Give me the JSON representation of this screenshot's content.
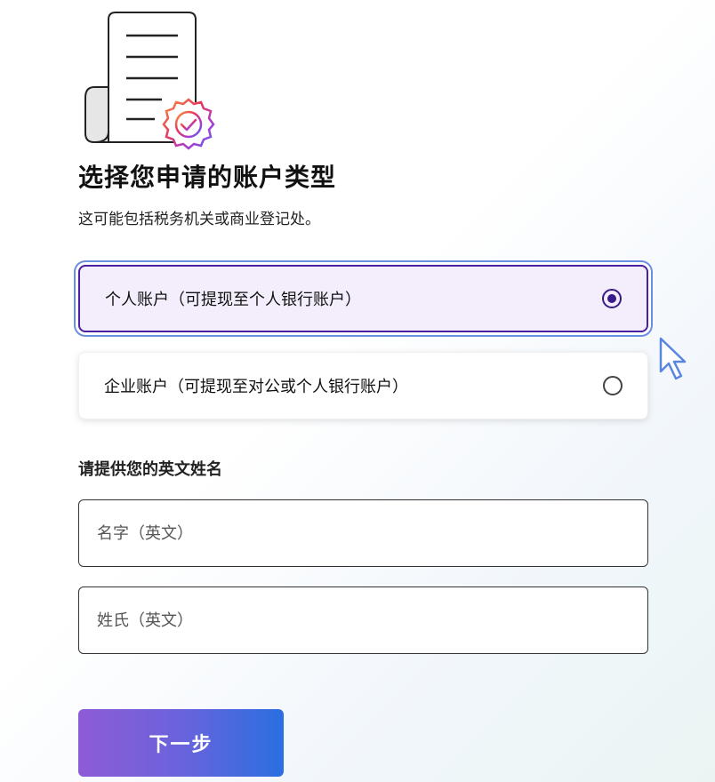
{
  "header": {
    "title": "选择您申请的账户类型",
    "subtitle": "这可能包括税务机关或商业登记处。"
  },
  "account_options": [
    {
      "label": "个人账户（可提现至个人银行账户）",
      "selected": true
    },
    {
      "label": "企业账户（可提现至对公或个人银行账户）",
      "selected": false
    }
  ],
  "name_section": {
    "label": "请提供您的英文姓名",
    "first_name": {
      "placeholder": "名字（英文）",
      "value": ""
    },
    "last_name": {
      "placeholder": "姓氏（英文）",
      "value": ""
    }
  },
  "actions": {
    "next_label": "下一步"
  },
  "colors": {
    "selected_border": "#4a1fa0",
    "selected_bg": "#f4eefc",
    "focus_ring": "#6b8fe0",
    "button_gradient_start": "#8e5bd6",
    "button_gradient_end": "#2a6fe0"
  },
  "icons": {
    "illustration": "document-with-verified-badge-icon",
    "cursor": "mouse-pointer-icon"
  }
}
